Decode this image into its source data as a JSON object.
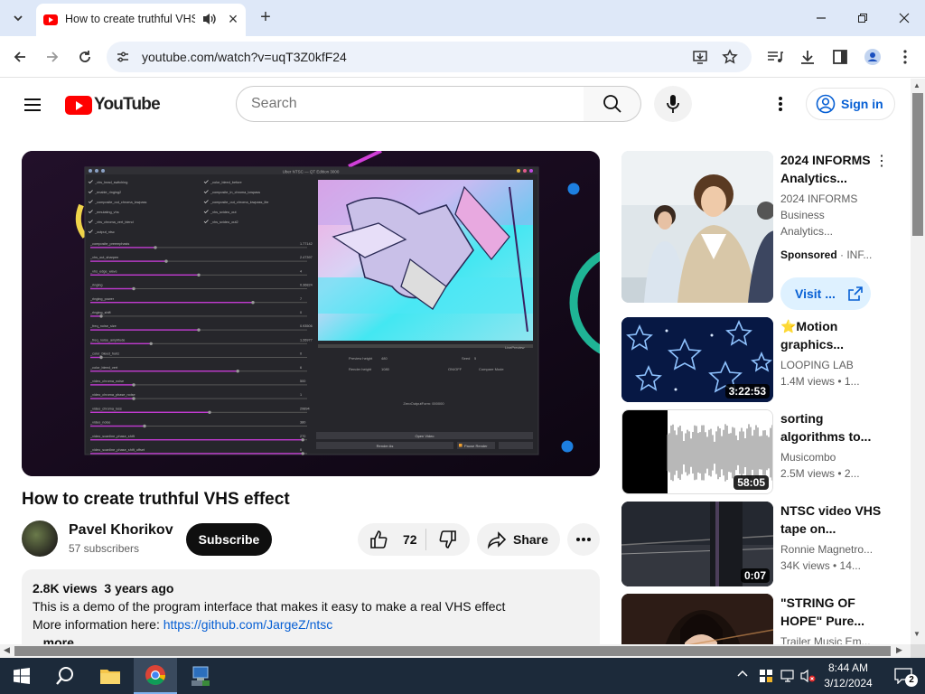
{
  "browser": {
    "tab": {
      "title": "How to create truthful VHS effect - YouTube"
    },
    "url": "youtube.com/watch?v=uqT3Z0kfF24"
  },
  "youtube": {
    "logo_text": "YouTube",
    "search_placeholder": "Search",
    "sign_in_label": "Sign in"
  },
  "video": {
    "title": "How to create truthful VHS effect",
    "channel": "Pavel Khorikov",
    "subscribers": "57 subscribers",
    "subscribe_label": "Subscribe",
    "likes": "72",
    "share_label": "Share",
    "description": {
      "views": "2.8K views",
      "age": "3 years ago",
      "line1": "This is a demo of the program interface that makes it easy to make a real VHS effect",
      "line2_prefix": "More information here: ",
      "link": "https://github.com/JargeZ/ntsc",
      "more": "...more"
    }
  },
  "player_screen": {
    "window_title": "Uber NTSC — QT Edition 3000",
    "sliders": [
      "_composite_preemphasis",
      "_vhs_out_sharpen",
      "_vhs_edge_wave",
      "_ringing",
      "_ringing_power",
      "_ringing_shift",
      "_freq_noise_size",
      "_freq_noise_amplitude",
      "_color_bleed_horiz",
      "_color_bleed_vert",
      "_video_chroma_noise",
      "_video_chroma_phase_noise",
      "_video_chroma_loss",
      "_video_noise",
      "_video_scanline_phase_shift",
      "_video_scanline_phase_shift_offset"
    ],
    "slider_values": [
      "1.77142",
      "2.47397",
      "4",
      "0.36824",
      "7",
      "0",
      "0.93506",
      "1.26977",
      "0",
      "6",
      "500",
      "1",
      "29894",
      "380",
      "270",
      "0"
    ],
    "checks_left": [
      "_vhs_head_switching",
      "_enable_ringing2",
      "_composite_out_chroma_lowpass",
      "_emulating_vhs",
      "_vhs_chroma_vert_blend",
      "_output_ntsc"
    ],
    "checks_right": [
      "_color_bleed_before",
      "_composite_in_chroma_lowpass",
      "_composite_out_chroma_lowpass_lite",
      "_vhs_svideo_out",
      "_vhs_svideo_out2"
    ],
    "preview_label": "Preview height",
    "preview_value": "480",
    "render_label": "Render height",
    "render_value": "1080",
    "seed_label": "Seed",
    "seed_value": "5",
    "onoff_label": "ON/OFF",
    "compare_label": "Compare Mode",
    "live_label": "LivePreview",
    "zero_label": "ZeroOutputForm: 000000",
    "open_btn": "Open Video",
    "render_btn": "Render As",
    "pause_btn": "Pause Render"
  },
  "recommendations": [
    {
      "title": "2024 INFORMS Analytics...",
      "channel": "2024 INFORMS Business Analytics...",
      "sponsored_label": "Sponsored",
      "advertiser": "INF...",
      "visit_label": "Visit ..."
    },
    {
      "title": "⭐Motion graphics...",
      "channel": "LOOPING LAB",
      "meta": "1.4M views • 1...",
      "duration": "3:22:53"
    },
    {
      "title": "sorting algorithms to...",
      "channel": "Musicombo",
      "meta": "2.5M views • 2...",
      "duration": "58:05"
    },
    {
      "title": "NTSC video VHS tape on...",
      "channel": "Ronnie Magnetro...",
      "meta": "34K views • 14...",
      "duration": "0:07"
    },
    {
      "title": "\"STRING OF HOPE\" Pure...",
      "channel": "Trailer Music Em..."
    }
  ],
  "taskbar": {
    "time": "8:44 AM",
    "date": "3/12/2024",
    "notification_count": "2"
  },
  "colors": {
    "youtube_red": "#ff0000",
    "link_blue": "#065fd4",
    "tabbar_bg": "#dee8f8",
    "taskbar_bg": "#1c2a3a",
    "player_bg": "#16091c"
  }
}
